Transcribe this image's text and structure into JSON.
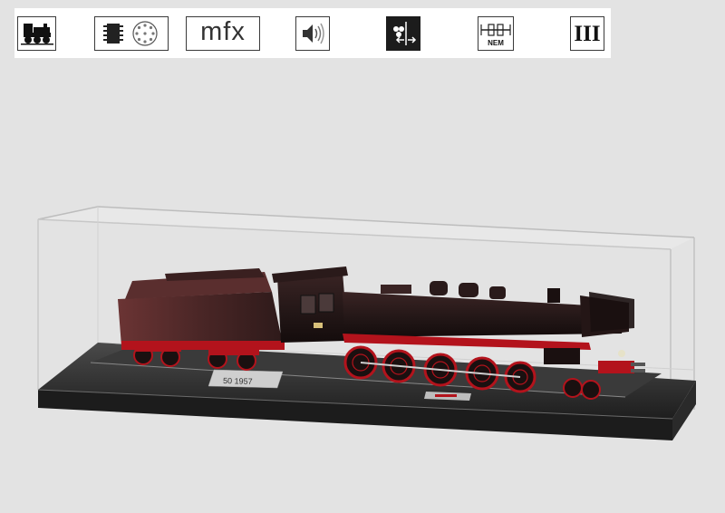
{
  "icons": [
    {
      "name": "steam-locomotive-icon"
    },
    {
      "name": "digital-decoder-icon"
    },
    {
      "name": "mfx-icon",
      "label": "mfx"
    },
    {
      "name": "sound-icon"
    },
    {
      "name": "lights-direction-icon"
    },
    {
      "name": "nem-coupler-icon",
      "label": "NEM"
    },
    {
      "name": "era-iii-icon",
      "label": "III"
    }
  ],
  "display": {
    "plaque_label": "50 1957"
  },
  "colors": {
    "background": "#e3e3e3",
    "loco_body": "#2a1c1c",
    "wheels_red": "#b3131c",
    "base": "#2c2c2c"
  }
}
